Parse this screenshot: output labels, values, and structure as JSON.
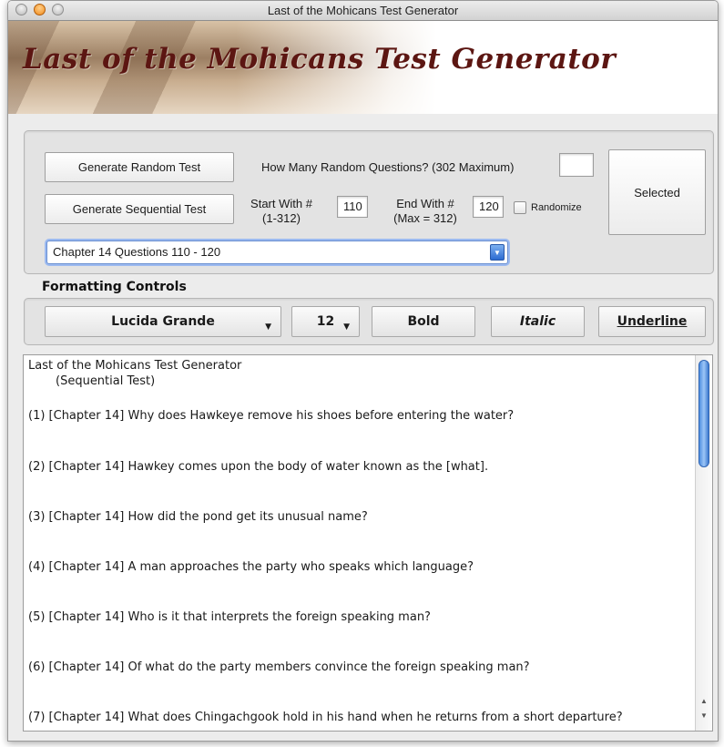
{
  "window": {
    "title": "Last of the Mohicans Test Generator"
  },
  "banner": {
    "title": "Last of the Mohicans Test Generator"
  },
  "controls": {
    "random_button": "Generate Random Test",
    "random_question_label": "How Many Random Questions? (302 Maximum)",
    "random_count_value": "",
    "sequential_button": "Generate Sequential Test",
    "start_label": "Start With #",
    "start_hint": "(1-312)",
    "start_value": "110",
    "end_label": "End With #",
    "end_hint": "(Max = 312)",
    "end_value": "120",
    "randomize_label": "Randomize",
    "randomize_checked": false,
    "selected_button": "Selected",
    "chapter_select": "Chapter 14 Questions 110 - 120"
  },
  "formatting": {
    "title": "Formatting Controls",
    "font": "Lucida Grande",
    "size": "12",
    "bold": "Bold",
    "italic": "Italic",
    "underline": "Underline"
  },
  "document": {
    "title": "Last of the Mohicans Test Generator",
    "subtitle": "(Sequential Test)",
    "questions": [
      "(1)  [Chapter 14] Why does Hawkeye remove his shoes before entering the water?",
      "(2)  [Chapter 14] Hawkey comes upon the body of water known as the [what].",
      "(3)  [Chapter 14] How did the pond get its unusual name?",
      "(4)  [Chapter 14] A man approaches the party who speaks which language?",
      "(5)  [Chapter 14] Who is it that interprets the foreign speaking man?",
      "(6)  [Chapter 14] Of what do the party members convince the foreign speaking man?",
      "(7)  [Chapter 14] What does Chingachgook hold in his hand when he returns from a short departure?"
    ]
  },
  "colors": {
    "banner_text": "#5c1612",
    "accent_blue": "#2c6bd1",
    "window_bg": "#ececec"
  },
  "icons": {
    "window_close": "close-icon",
    "window_minimize": "minimize-icon",
    "window_zoom": "zoom-icon",
    "dropdown": "chevron-down-icon"
  }
}
